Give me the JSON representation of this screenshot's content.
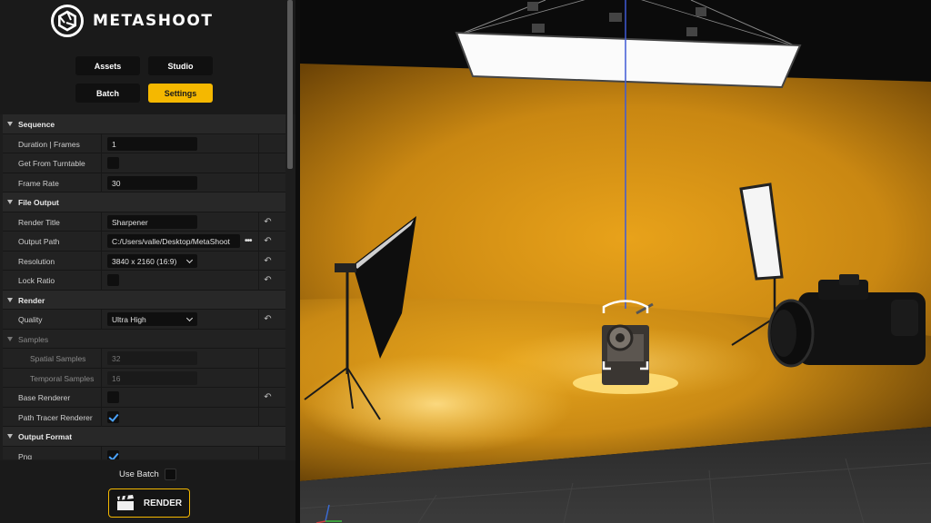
{
  "app": {
    "brand": "METASHOOT"
  },
  "tabs": [
    {
      "label": "Assets",
      "active": false
    },
    {
      "label": "Studio",
      "active": false
    },
    {
      "label": "Batch",
      "active": false
    },
    {
      "label": "Settings",
      "active": true
    }
  ],
  "sections": {
    "sequence": "Sequence",
    "file_output": "File Output",
    "render": "Render",
    "samples": "Samples",
    "output_format": "Output Format"
  },
  "props": {
    "duration": {
      "label": "Duration | Frames",
      "value": "1"
    },
    "get_from_turntable": {
      "label": "Get From Turntable",
      "checked": false
    },
    "frame_rate": {
      "label": "Frame Rate",
      "value": "30"
    },
    "render_title": {
      "label": "Render Title",
      "value": "Sharpener"
    },
    "output_path": {
      "label": "Output Path",
      "value": "C:/Users/valle/Desktop/MetaShoot"
    },
    "resolution": {
      "label": "Resolution",
      "value": "3840 x 2160 (16:9)"
    },
    "lock_ratio": {
      "label": "Lock Ratio",
      "checked": false
    },
    "quality": {
      "label": "Quality",
      "value": "Ultra High"
    },
    "spatial_samples": {
      "label": "Spatial Samples",
      "value": "32"
    },
    "temporal_samples": {
      "label": "Temporal Samples",
      "value": "16"
    },
    "base_renderer": {
      "label": "Base Renderer",
      "checked": false
    },
    "path_tracer_renderer": {
      "label": "Path Tracer Renderer",
      "checked": true
    },
    "png": {
      "label": "Png",
      "checked": true
    }
  },
  "footer": {
    "use_batch_label": "Use Batch",
    "use_batch_checked": false,
    "render_label": "RENDER"
  },
  "icons": {
    "reset": "reset-arrow-icon",
    "browse": "ellipsis-icon",
    "render": "clapperboard-icon",
    "logo": "camera-shutter-icon"
  },
  "colors": {
    "accent": "#f5b800",
    "studio_backdrop": "#d99a16",
    "check_tick": "#4aa3ff"
  }
}
